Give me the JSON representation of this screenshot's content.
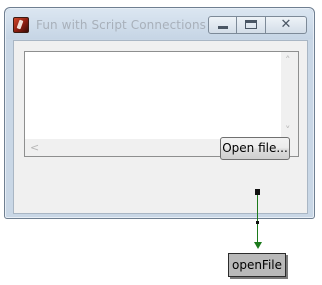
{
  "window": {
    "title": "Fun with Script Connections",
    "icons": {
      "app": "app-icon",
      "minimize": "minimize-icon",
      "maximize": "maximize-icon",
      "close": "close-icon"
    },
    "close_glyph": "✕"
  },
  "textarea": {
    "value": "",
    "scroll_arrows": {
      "up": "˄",
      "down": "˅",
      "left": "<",
      "right": ">"
    }
  },
  "button": {
    "label": "Open file..."
  },
  "connection": {
    "target_node": "openFile",
    "line_color": "#1c7a1c"
  }
}
